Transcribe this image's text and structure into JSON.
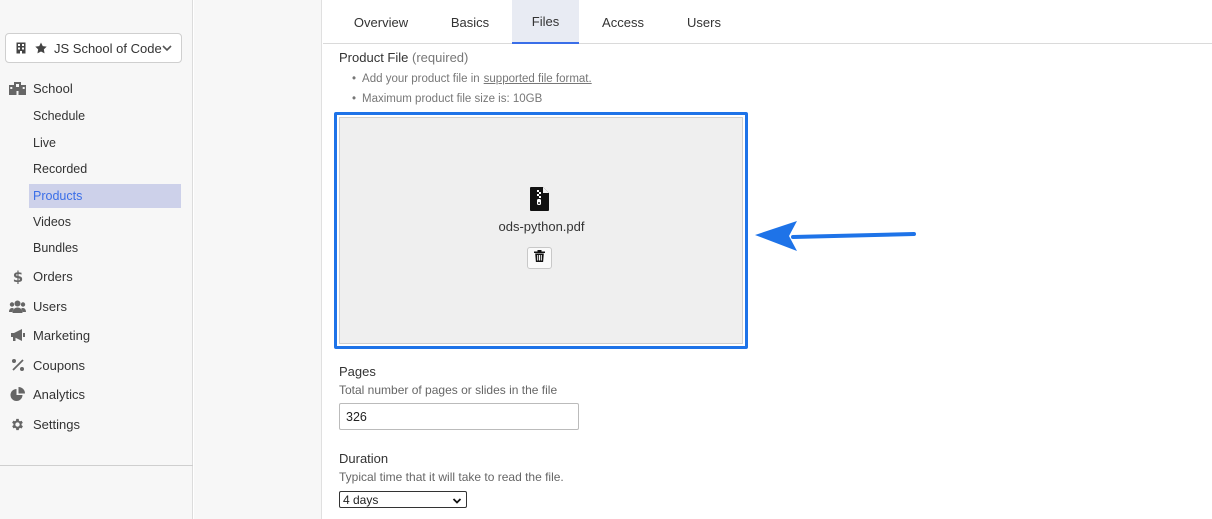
{
  "sidebar": {
    "school_select": {
      "label": "JS School of Code",
      "icons": [
        "building-icon",
        "star-icon",
        "chevron-down-icon"
      ]
    },
    "items": [
      {
        "label": "School",
        "icon": "school-icon"
      },
      {
        "label": "Schedule"
      },
      {
        "label": "Live"
      },
      {
        "label": "Recorded"
      },
      {
        "label": "Products",
        "active": true
      },
      {
        "label": "Videos"
      },
      {
        "label": "Bundles"
      },
      {
        "label": "Orders",
        "icon": "dollar-icon"
      },
      {
        "label": "Users",
        "icon": "users-icon"
      },
      {
        "label": "Marketing",
        "icon": "megaphone-icon"
      },
      {
        "label": "Coupons",
        "icon": "percent-icon"
      },
      {
        "label": "Analytics",
        "icon": "pie-chart-icon"
      },
      {
        "label": "Settings",
        "icon": "gear-icon"
      }
    ]
  },
  "tabs": [
    {
      "label": "Overview"
    },
    {
      "label": "Basics"
    },
    {
      "label": "Files",
      "active": true
    },
    {
      "label": "Access"
    },
    {
      "label": "Users"
    }
  ],
  "product_file": {
    "label": "Product File",
    "required": "(required)",
    "bullet1_prefix": "Add your product file in",
    "bullet1_link": "supported file format.",
    "bullet2": "Maximum product file size is: 10GB",
    "file_name": "ods-python.pdf",
    "file_icon": "zip-file-icon",
    "delete_icon": "trash-icon"
  },
  "pages": {
    "label": "Pages",
    "hint": "Total number of pages or slides in the file",
    "value": "326"
  },
  "duration": {
    "label": "Duration",
    "hint": "Typical time that it will take to read the file.",
    "value": "4 days"
  },
  "colors": {
    "accent": "#1e73e8",
    "active_nav_bg": "#cdd1ea",
    "active_nav_text": "#3a6ee8"
  }
}
